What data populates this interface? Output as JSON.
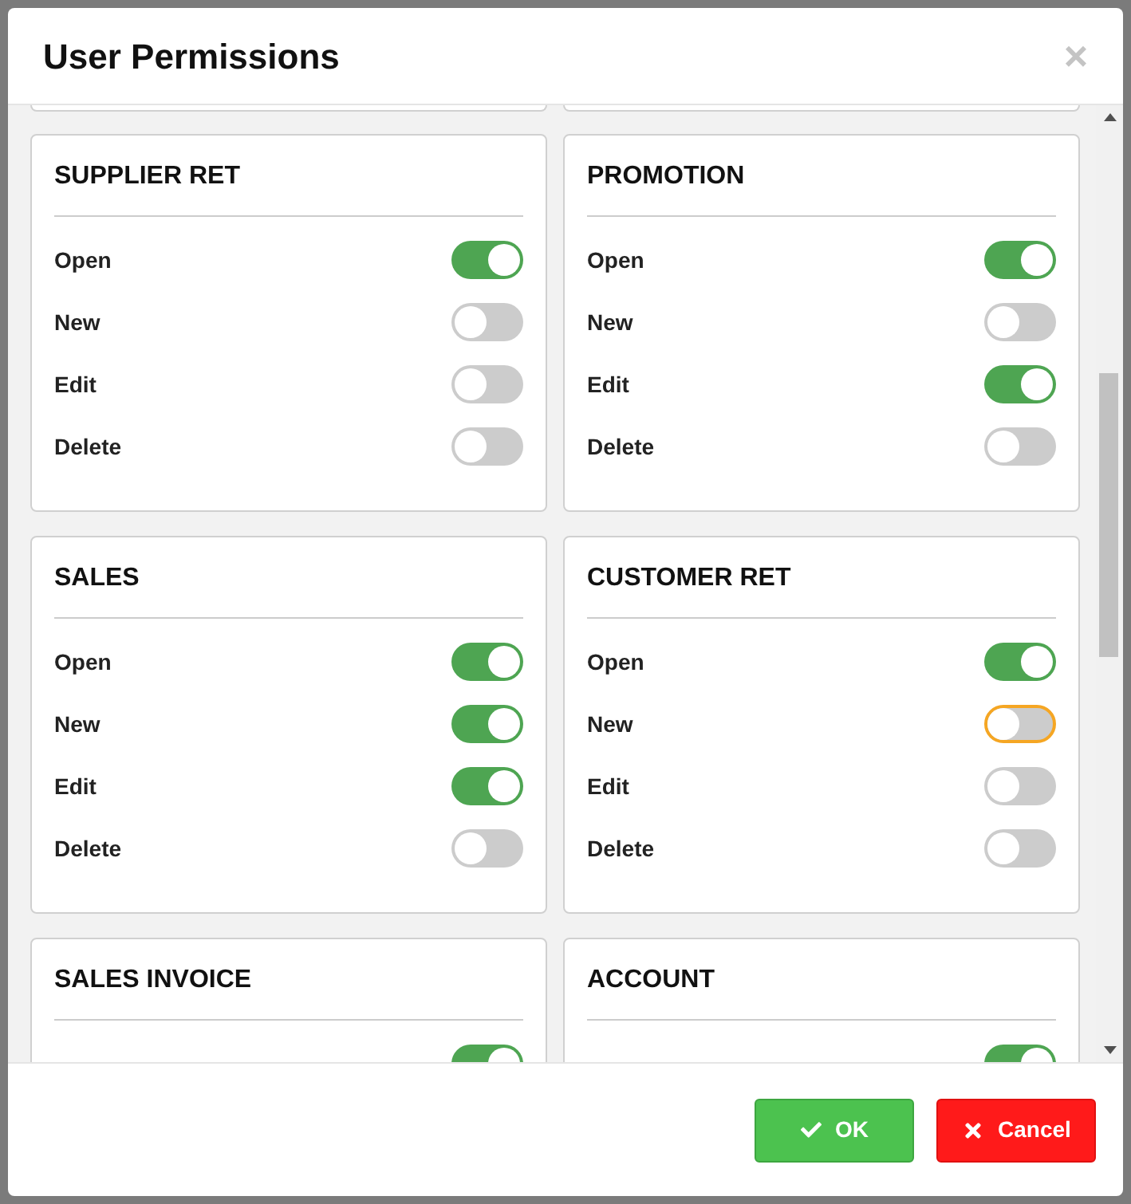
{
  "dialog": {
    "title": "User Permissions",
    "close": "×"
  },
  "cards": [
    {
      "title": "SUPPLIER RET",
      "rows": [
        {
          "label": "Open",
          "on": true,
          "focused": false
        },
        {
          "label": "New",
          "on": false,
          "focused": false
        },
        {
          "label": "Edit",
          "on": false,
          "focused": false
        },
        {
          "label": "Delete",
          "on": false,
          "focused": false
        }
      ]
    },
    {
      "title": "PROMOTION",
      "rows": [
        {
          "label": "Open",
          "on": true,
          "focused": false
        },
        {
          "label": "New",
          "on": false,
          "focused": false
        },
        {
          "label": "Edit",
          "on": true,
          "focused": false
        },
        {
          "label": "Delete",
          "on": false,
          "focused": false
        }
      ]
    },
    {
      "title": "SALES",
      "rows": [
        {
          "label": "Open",
          "on": true,
          "focused": false
        },
        {
          "label": "New",
          "on": true,
          "focused": false
        },
        {
          "label": "Edit",
          "on": true,
          "focused": false
        },
        {
          "label": "Delete",
          "on": false,
          "focused": false
        }
      ]
    },
    {
      "title": "CUSTOMER RET",
      "rows": [
        {
          "label": "Open",
          "on": true,
          "focused": false
        },
        {
          "label": "New",
          "on": false,
          "focused": true
        },
        {
          "label": "Edit",
          "on": false,
          "focused": false
        },
        {
          "label": "Delete",
          "on": false,
          "focused": false
        }
      ]
    },
    {
      "title": "SALES INVOICE",
      "rows": [
        {
          "on": true,
          "focused": false
        }
      ]
    },
    {
      "title": "ACCOUNT",
      "rows": [
        {
          "on": true,
          "focused": false
        }
      ]
    }
  ],
  "buttons": [
    {
      "kind": "ok",
      "label": "OK"
    },
    {
      "kind": "cancel",
      "label": "Cancel"
    }
  ]
}
